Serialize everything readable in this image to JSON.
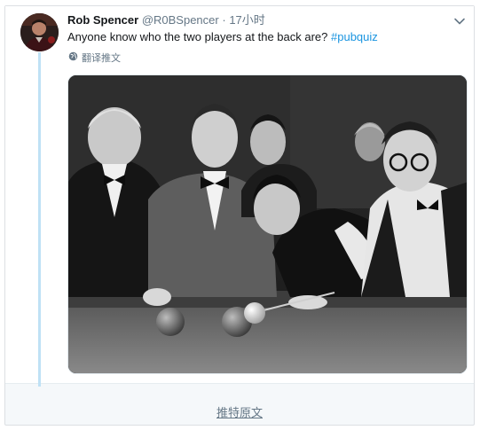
{
  "tweet": {
    "author_name": "Rob Spencer",
    "author_handle": "@R0BSpencer",
    "separator": "·",
    "time_ago": "17小时",
    "text_main": "Anyone know who the two players at the back are? ",
    "hashtag": "#pubquiz",
    "translate_label": "翻译推文",
    "translate_icon": "globe-icon",
    "menu_icon": "chevron-down-icon"
  },
  "footer": {
    "view_original": "推特原文"
  },
  "colors": {
    "link_blue": "#1b95e0",
    "thread_line": "#bfe1f5",
    "muted": "#657786"
  }
}
